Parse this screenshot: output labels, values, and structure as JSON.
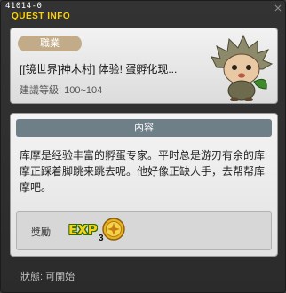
{
  "window": {
    "quest_id": "41014-0",
    "title": "QUEST INFO"
  },
  "header": {
    "job_badge": "職業",
    "quest_name": "[[镜世界]神木村] 体验! 蛋孵化现...",
    "level_requirement": "建議等級: 100~104"
  },
  "content": {
    "section_title": "內容",
    "description": "库摩是经验丰富的孵蛋专家。平时总是游刃有余的库摩正踩着脚跳来跳去呢。他好像正缺人手，去帮帮库摩吧。"
  },
  "reward": {
    "label": "獎勵",
    "exp_text": "EXP",
    "item_quantity": "3"
  },
  "status": {
    "text": "狀態: 可開始"
  },
  "colors": {
    "title_yellow": "#ffd400",
    "badge_tan": "#c2ab88",
    "section_header": "#6f7f88",
    "exp_yellow": "#f7d21a"
  },
  "icons": {
    "close": "close-icon",
    "npc": "npc-portrait-icon",
    "exp": "exp-icon",
    "coin": "gold-coin-icon"
  }
}
